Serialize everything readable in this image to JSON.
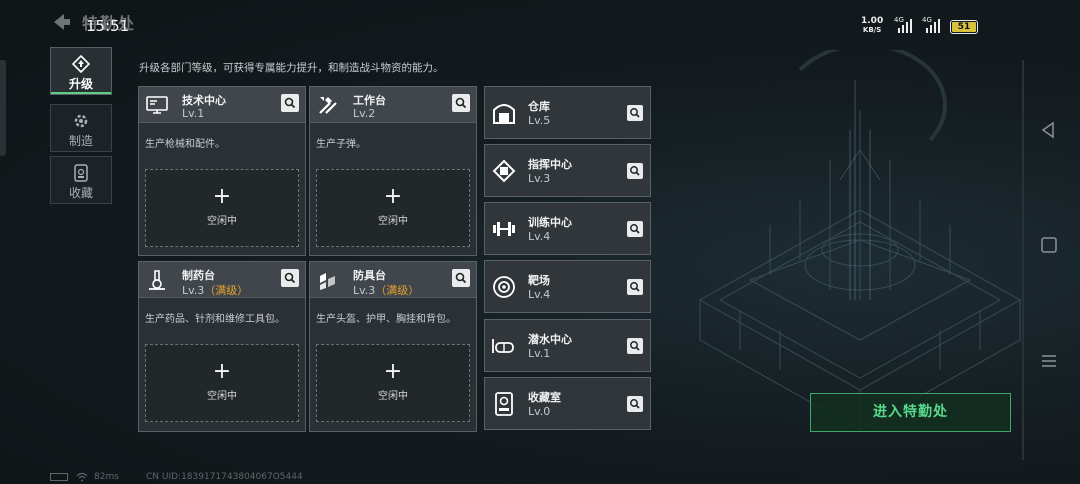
{
  "header": {
    "title": "特勤处",
    "clock": "15:51"
  },
  "status_bar": {
    "speed": "1.00",
    "speed_unit": "KB/S",
    "network_1": "4G",
    "network_2": "4G",
    "battery": "51",
    "battery_color": "#d8c23a"
  },
  "tabs": [
    {
      "label": "升级",
      "icon": "upgrade-icon"
    },
    {
      "label": "制造",
      "icon": "gear-icon"
    },
    {
      "label": "收藏",
      "icon": "collection-icon"
    }
  ],
  "intro": "升级各部门等级，可获得专属能力提升，和制造战斗物资的能力。",
  "departments": [
    {
      "name": "技术中心",
      "level": "Lv.1",
      "level_note": "",
      "description": "生产枪械和配件。",
      "slot": "空闲中",
      "icon": "monitor-icon"
    },
    {
      "name": "工作台",
      "level": "Lv.2",
      "level_note": "",
      "description": "生产子弹。",
      "slot": "空闲中",
      "icon": "tools-icon"
    },
    {
      "name": "制药台",
      "level": "Lv.3",
      "level_note": "（满级）",
      "description": "生产药品、针剂和维修工具包。",
      "slot": "空闲中",
      "icon": "microscope-icon"
    },
    {
      "name": "防具台",
      "level": "Lv.3",
      "level_note": "（满级）",
      "description": "生产头盔、护甲、胸挂和背包。",
      "slot": "空闲中",
      "icon": "armor-icon"
    }
  ],
  "facilities": [
    {
      "name": "仓库",
      "level": "Lv.5",
      "icon": "warehouse-icon"
    },
    {
      "name": "指挥中心",
      "level": "Lv.3",
      "icon": "chip-icon"
    },
    {
      "name": "训练中心",
      "level": "Lv.4",
      "icon": "dumbbell-icon"
    },
    {
      "name": "靶场",
      "level": "Lv.4",
      "icon": "target-icon"
    },
    {
      "name": "潜水中心",
      "level": "Lv.1",
      "icon": "diving-mask-icon"
    },
    {
      "name": "收藏室",
      "level": "Lv.0",
      "icon": "display-case-icon"
    }
  ],
  "enter_button": "进入特勤处",
  "footer": {
    "ping": "82ms",
    "uid": "CN UID:1839171743804067O5444"
  },
  "colors": {
    "accent": "#5ccf83",
    "max_level": "#e5a12c"
  }
}
